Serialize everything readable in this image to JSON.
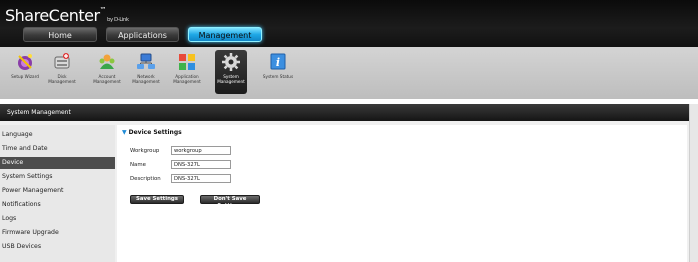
{
  "header": {
    "brand": "ShareCenter",
    "brand_tm": "™",
    "brand_by": "by D-Link"
  },
  "nav": {
    "tabs": [
      {
        "label": "Home"
      },
      {
        "label": "Applications"
      },
      {
        "label": "Management"
      }
    ],
    "active": "Management"
  },
  "toolbar": {
    "items": [
      {
        "label": "Setup Wizard",
        "icon": "wizard-icon"
      },
      {
        "label": "Disk Management",
        "icon": "disk-icon"
      },
      {
        "label": "Account Management",
        "icon": "account-icon"
      },
      {
        "label": "Network Management",
        "icon": "network-icon"
      },
      {
        "label": "Application Management",
        "icon": "application-icon"
      },
      {
        "label": "System Management",
        "icon": "gear-icon"
      },
      {
        "label": "System Status",
        "icon": "info-icon"
      }
    ]
  },
  "panel": {
    "title": "System Management"
  },
  "sidebar": {
    "items": [
      {
        "label": "Language"
      },
      {
        "label": "Time and Date"
      },
      {
        "label": "Device"
      },
      {
        "label": "System Settings"
      },
      {
        "label": "Power Management"
      },
      {
        "label": "Notifications"
      },
      {
        "label": "Logs"
      },
      {
        "label": "Firmware Upgrade"
      },
      {
        "label": "USB Devices"
      }
    ],
    "active": "Device"
  },
  "device_settings": {
    "title": "Device Settings",
    "fields": [
      {
        "label": "Workgroup",
        "value": "workgroup"
      },
      {
        "label": "Name",
        "value": "DNS-327L"
      },
      {
        "label": "Description",
        "value": "DNS-327L"
      }
    ],
    "save_label": "Save Settings",
    "dont_save_label": "Don't Save Settings"
  },
  "colors": {
    "accent": "#1fa8e6",
    "header_bg": "#111111",
    "active_item": "#4d4d4d"
  }
}
